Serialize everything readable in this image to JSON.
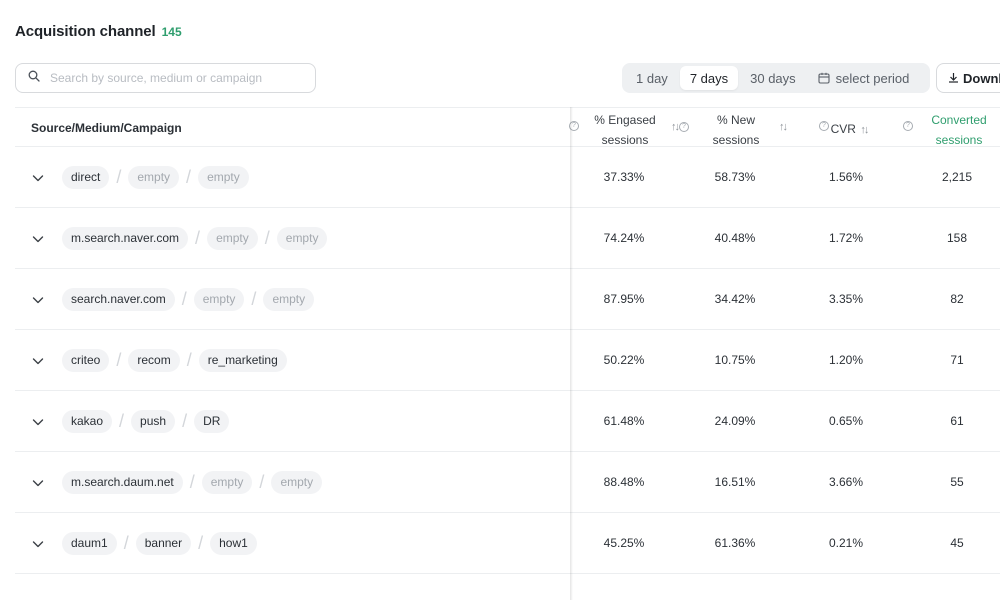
{
  "header": {
    "title": "Acquisition channel",
    "count": "145"
  },
  "search": {
    "placeholder": "Search by source, medium or campaign",
    "icon": "search-icon"
  },
  "period": {
    "options": [
      "1 day",
      "7 days",
      "30 days",
      "select period"
    ],
    "selected": "7 days"
  },
  "download": {
    "label": "Downl"
  },
  "table": {
    "source_header": "Source/Medium/Campaign",
    "columns": [
      {
        "line1": "% Engased",
        "line2": "sessions"
      },
      {
        "line1": "% New",
        "line2": "sessions"
      },
      {
        "label": "CVR"
      },
      {
        "line1": "Converted",
        "line2": "sessions"
      }
    ],
    "rows": [
      {
        "source": "direct",
        "medium": "empty",
        "campaign": "empty",
        "engaged": "37.33%",
        "new": "58.73%",
        "cvr": "1.56%",
        "converted": "2,215"
      },
      {
        "source": "m.search.naver.com",
        "medium": "empty",
        "campaign": "empty",
        "engaged": "74.24%",
        "new": "40.48%",
        "cvr": "1.72%",
        "converted": "158"
      },
      {
        "source": "search.naver.com",
        "medium": "empty",
        "campaign": "empty",
        "engaged": "87.95%",
        "new": "34.42%",
        "cvr": "3.35%",
        "converted": "82"
      },
      {
        "source": "criteo",
        "medium": "recom",
        "campaign": "re_marketing",
        "engaged": "50.22%",
        "new": "10.75%",
        "cvr": "1.20%",
        "converted": "71"
      },
      {
        "source": "kakao",
        "medium": "push",
        "campaign": "DR",
        "engaged": "61.48%",
        "new": "24.09%",
        "cvr": "0.65%",
        "converted": "61"
      },
      {
        "source": "m.search.daum.net",
        "medium": "empty",
        "campaign": "empty",
        "engaged": "88.48%",
        "new": "16.51%",
        "cvr": "3.66%",
        "converted": "55"
      },
      {
        "source": "daum1",
        "medium": "banner",
        "campaign": "how1",
        "engaged": "45.25%",
        "new": "61.36%",
        "cvr": "0.21%",
        "converted": "45"
      }
    ]
  },
  "colors": {
    "accent_green": "#2f9e6e",
    "chip_bg": "#f2f3f5",
    "empty_text": "#a3a8ae"
  }
}
